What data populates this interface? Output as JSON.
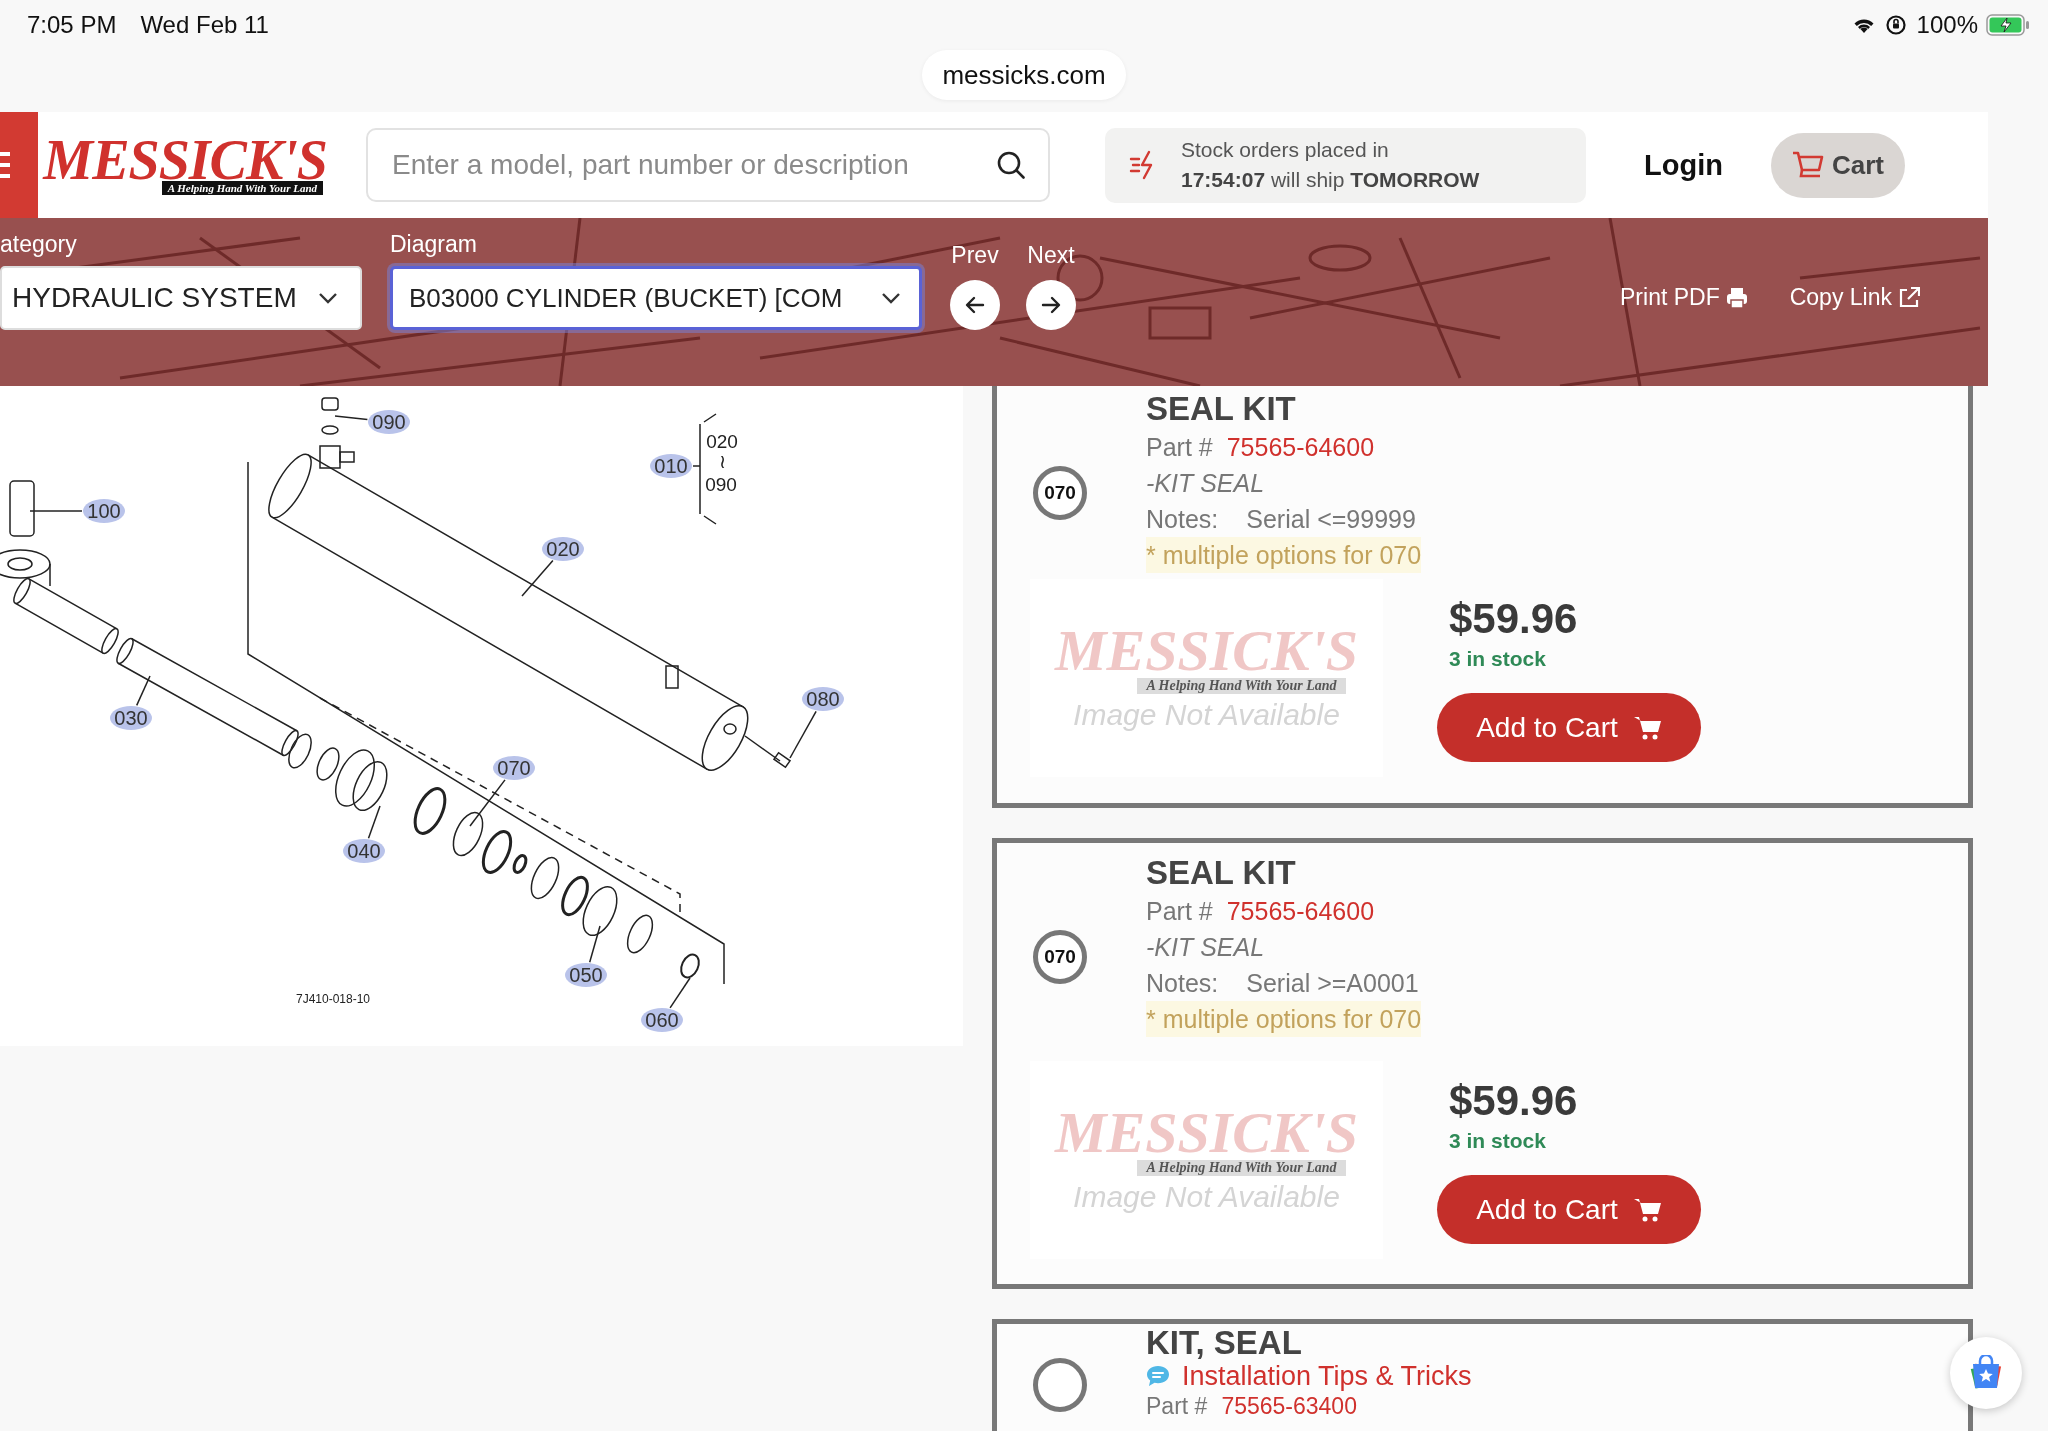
{
  "status_bar": {
    "time": "7:05 PM",
    "date": "Wed Feb 11",
    "battery": "100%"
  },
  "address_bar": {
    "url": "messicks.com"
  },
  "header": {
    "logo": {
      "name": "MESSICK'S",
      "tagline": "A Helping Hand With Your Land"
    },
    "search": {
      "placeholder": "Enter a model, part number or description"
    },
    "shipping_notice": {
      "text": "Stock orders placed in",
      "countdown": "17:54:07",
      "middle": "will ship",
      "day": "TOMORROW"
    },
    "login": "Login",
    "cart": "Cart"
  },
  "toolbar": {
    "selects": [
      {
        "label": "ategory",
        "value": "HYDRAULIC SYSTEM",
        "focused": false
      },
      {
        "label": "Diagram",
        "value": "B03000 CYLINDER (BUCKET) [COM",
        "focused": true
      }
    ],
    "prev": "Prev",
    "next": "Next",
    "print": "Print PDF",
    "copy_link": "Copy Link"
  },
  "diagram": {
    "callouts": [
      {
        "label": "090"
      },
      {
        "label": "100"
      },
      {
        "label": "010"
      },
      {
        "label": "020"
      },
      {
        "label": "030"
      },
      {
        "label": "080"
      },
      {
        "label": "070"
      },
      {
        "label": "040"
      },
      {
        "label": "050"
      },
      {
        "label": "060"
      }
    ],
    "range": {
      "from": "020",
      "mark": "≀",
      "to": "090"
    },
    "figure_code": "7J410-018-10"
  },
  "parts": [
    {
      "title": "SEAL KIT",
      "callout": "070",
      "part_label": "Part #",
      "part_number": "75565-64600",
      "description": "-KIT SEAL",
      "notes_label": "Notes:",
      "notes": "Serial <=99999",
      "options": "* multiple options for 070",
      "image": {
        "name": "MESSICK'S",
        "tagline": "A Helping Hand With Your Land",
        "caption": "Image Not Available"
      },
      "price": "$59.96",
      "stock": "3 in stock",
      "button": "Add to Cart"
    },
    {
      "title": "SEAL KIT",
      "callout": "070",
      "part_label": "Part #",
      "part_number": "75565-64600",
      "description": "-KIT SEAL",
      "notes_label": "Notes:",
      "notes": "Serial >=A0001",
      "options": "* multiple options for 070",
      "image": {
        "name": "MESSICK'S",
        "tagline": "A Helping Hand With Your Land",
        "caption": "Image Not Available"
      },
      "price": "$59.96",
      "stock": "3 in stock",
      "button": "Add to Cart"
    },
    {
      "title": "KIT, SEAL",
      "tip": "Installation Tips & Tricks",
      "part_label": "Part #",
      "part_number": "75565-63400"
    }
  ]
}
